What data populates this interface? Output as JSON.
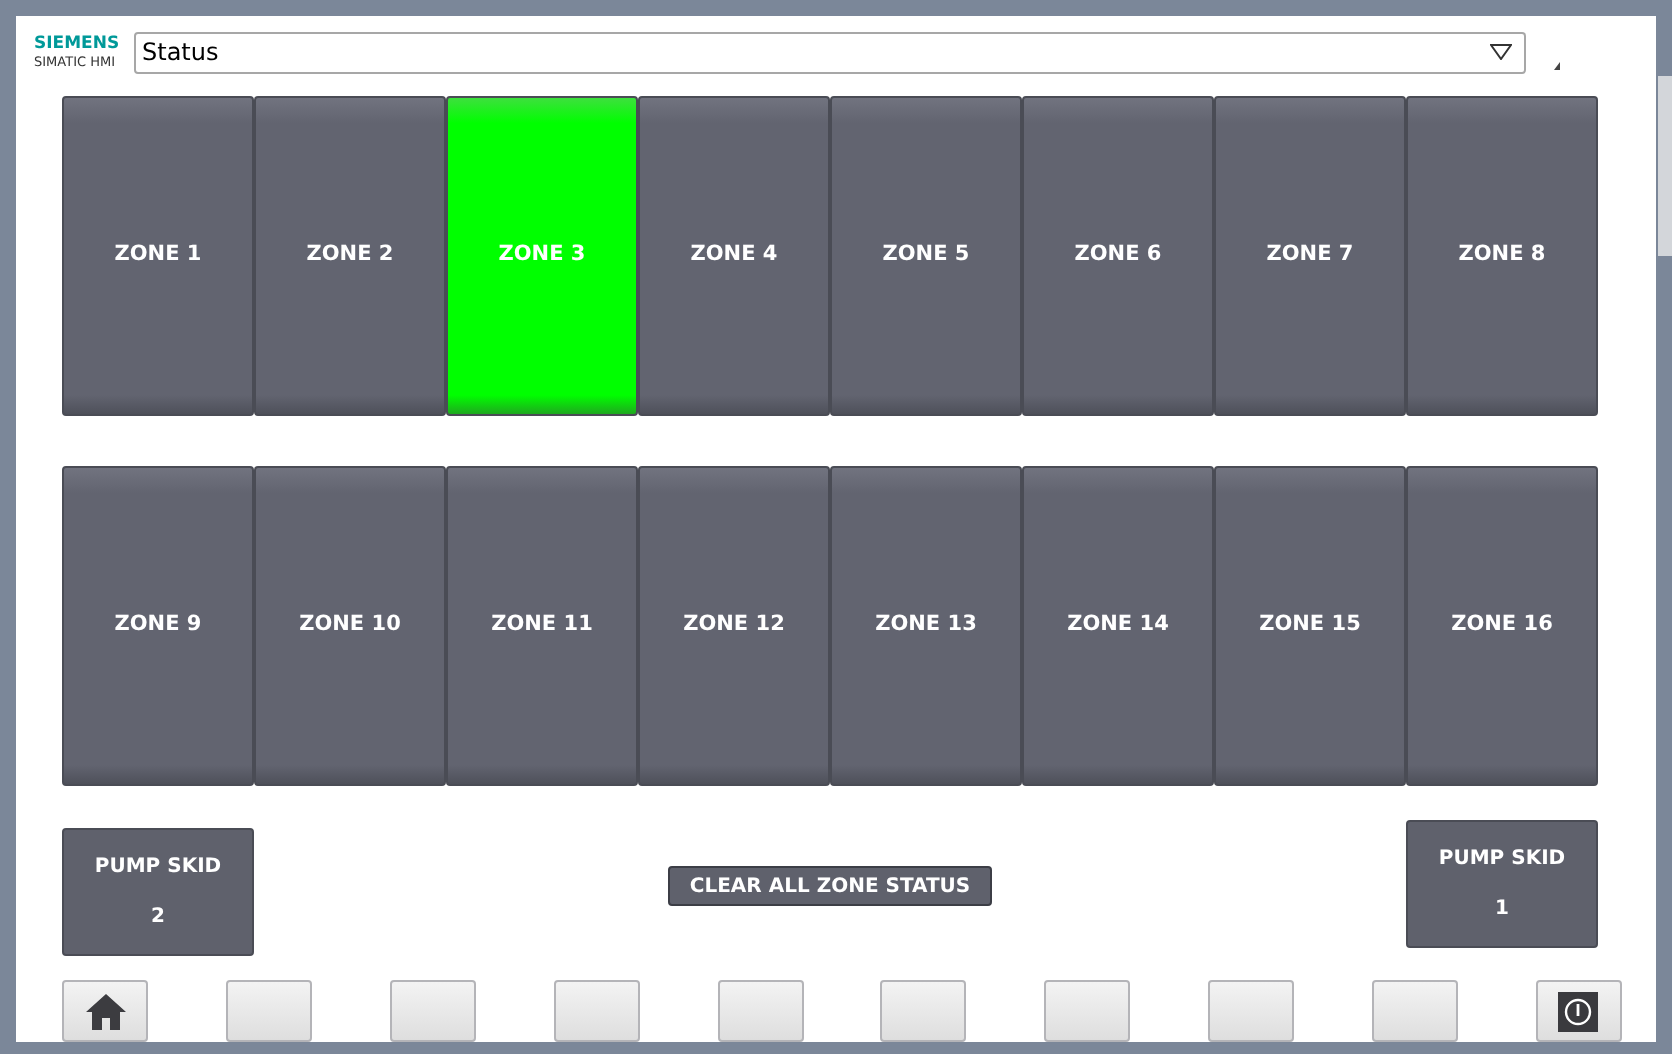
{
  "header": {
    "brand": "SIEMENS",
    "product": "SIMATIC HMI",
    "screen_select": "Status"
  },
  "zones": [
    {
      "label": "ZONE 1",
      "active": false
    },
    {
      "label": "ZONE 2",
      "active": false
    },
    {
      "label": "ZONE 3",
      "active": true
    },
    {
      "label": "ZONE 4",
      "active": false
    },
    {
      "label": "ZONE 5",
      "active": false
    },
    {
      "label": "ZONE 6",
      "active": false
    },
    {
      "label": "ZONE 7",
      "active": false
    },
    {
      "label": "ZONE 8",
      "active": false
    },
    {
      "label": "ZONE 9",
      "active": false
    },
    {
      "label": "ZONE 10",
      "active": false
    },
    {
      "label": "ZONE 11",
      "active": false
    },
    {
      "label": "ZONE 12",
      "active": false
    },
    {
      "label": "ZONE 13",
      "active": false
    },
    {
      "label": "ZONE 14",
      "active": false
    },
    {
      "label": "ZONE 15",
      "active": false
    },
    {
      "label": "ZONE 16",
      "active": false
    }
  ],
  "pump_skid_left": {
    "line_1": "PUMP SKID",
    "line_2": "2"
  },
  "clear_button": "CLEAR ALL ZONE STATUS",
  "pump_skid_right": {
    "line_1": "PUMP SKID",
    "line_2": "1"
  },
  "function_keys": [
    {
      "kind": "home"
    },
    {
      "kind": "blank"
    },
    {
      "kind": "blank"
    },
    {
      "kind": "blank"
    },
    {
      "kind": "blank"
    },
    {
      "kind": "blank"
    },
    {
      "kind": "blank"
    },
    {
      "kind": "blank"
    },
    {
      "kind": "blank"
    },
    {
      "kind": "power"
    }
  ]
}
